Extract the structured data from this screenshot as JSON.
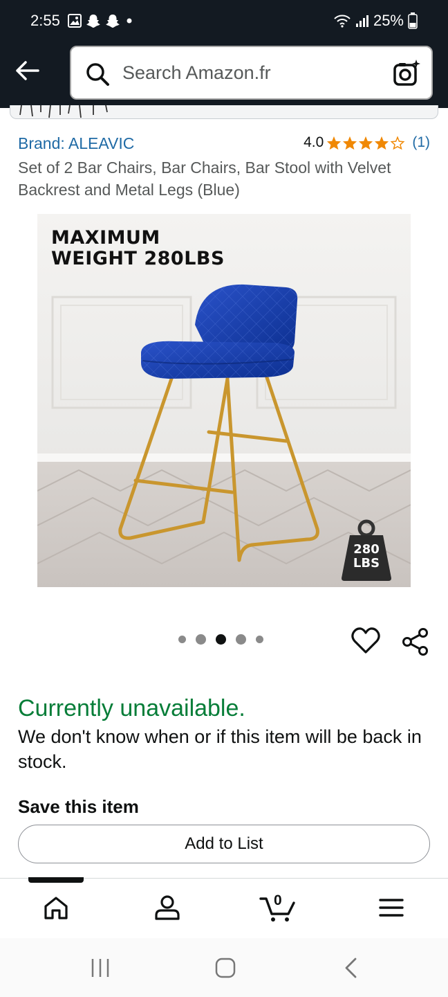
{
  "status_bar": {
    "time": "2:55",
    "battery": "25%"
  },
  "header": {
    "search_placeholder": "Search Amazon.fr"
  },
  "product": {
    "brand": "Brand: ALEAVIC",
    "rating_value": "4.0",
    "rating_stars": 4,
    "rating_count": "(1)",
    "title": "Set of 2 Bar Chairs, Bar Chairs, Bar Stool with Velvet Backrest and Metal Legs (Blue)",
    "image_caption_line1": "MAXIMUM",
    "image_caption_line2": "WEIGHT 280LBS",
    "badge_line1": "280",
    "badge_line2": "LBS"
  },
  "carousel": {
    "total": 5,
    "active_index": 2
  },
  "availability": {
    "status": "Currently unavailable.",
    "note": "We don't know when or if this item will be back in stock."
  },
  "save": {
    "title": "Save this item",
    "add_to_list": "Add to List"
  },
  "bottom_nav": {
    "cart_count": "0"
  },
  "colors": {
    "header_bg": "#131a22",
    "link": "#1f6aa5",
    "star": "#f08804",
    "availability": "#067d38"
  }
}
